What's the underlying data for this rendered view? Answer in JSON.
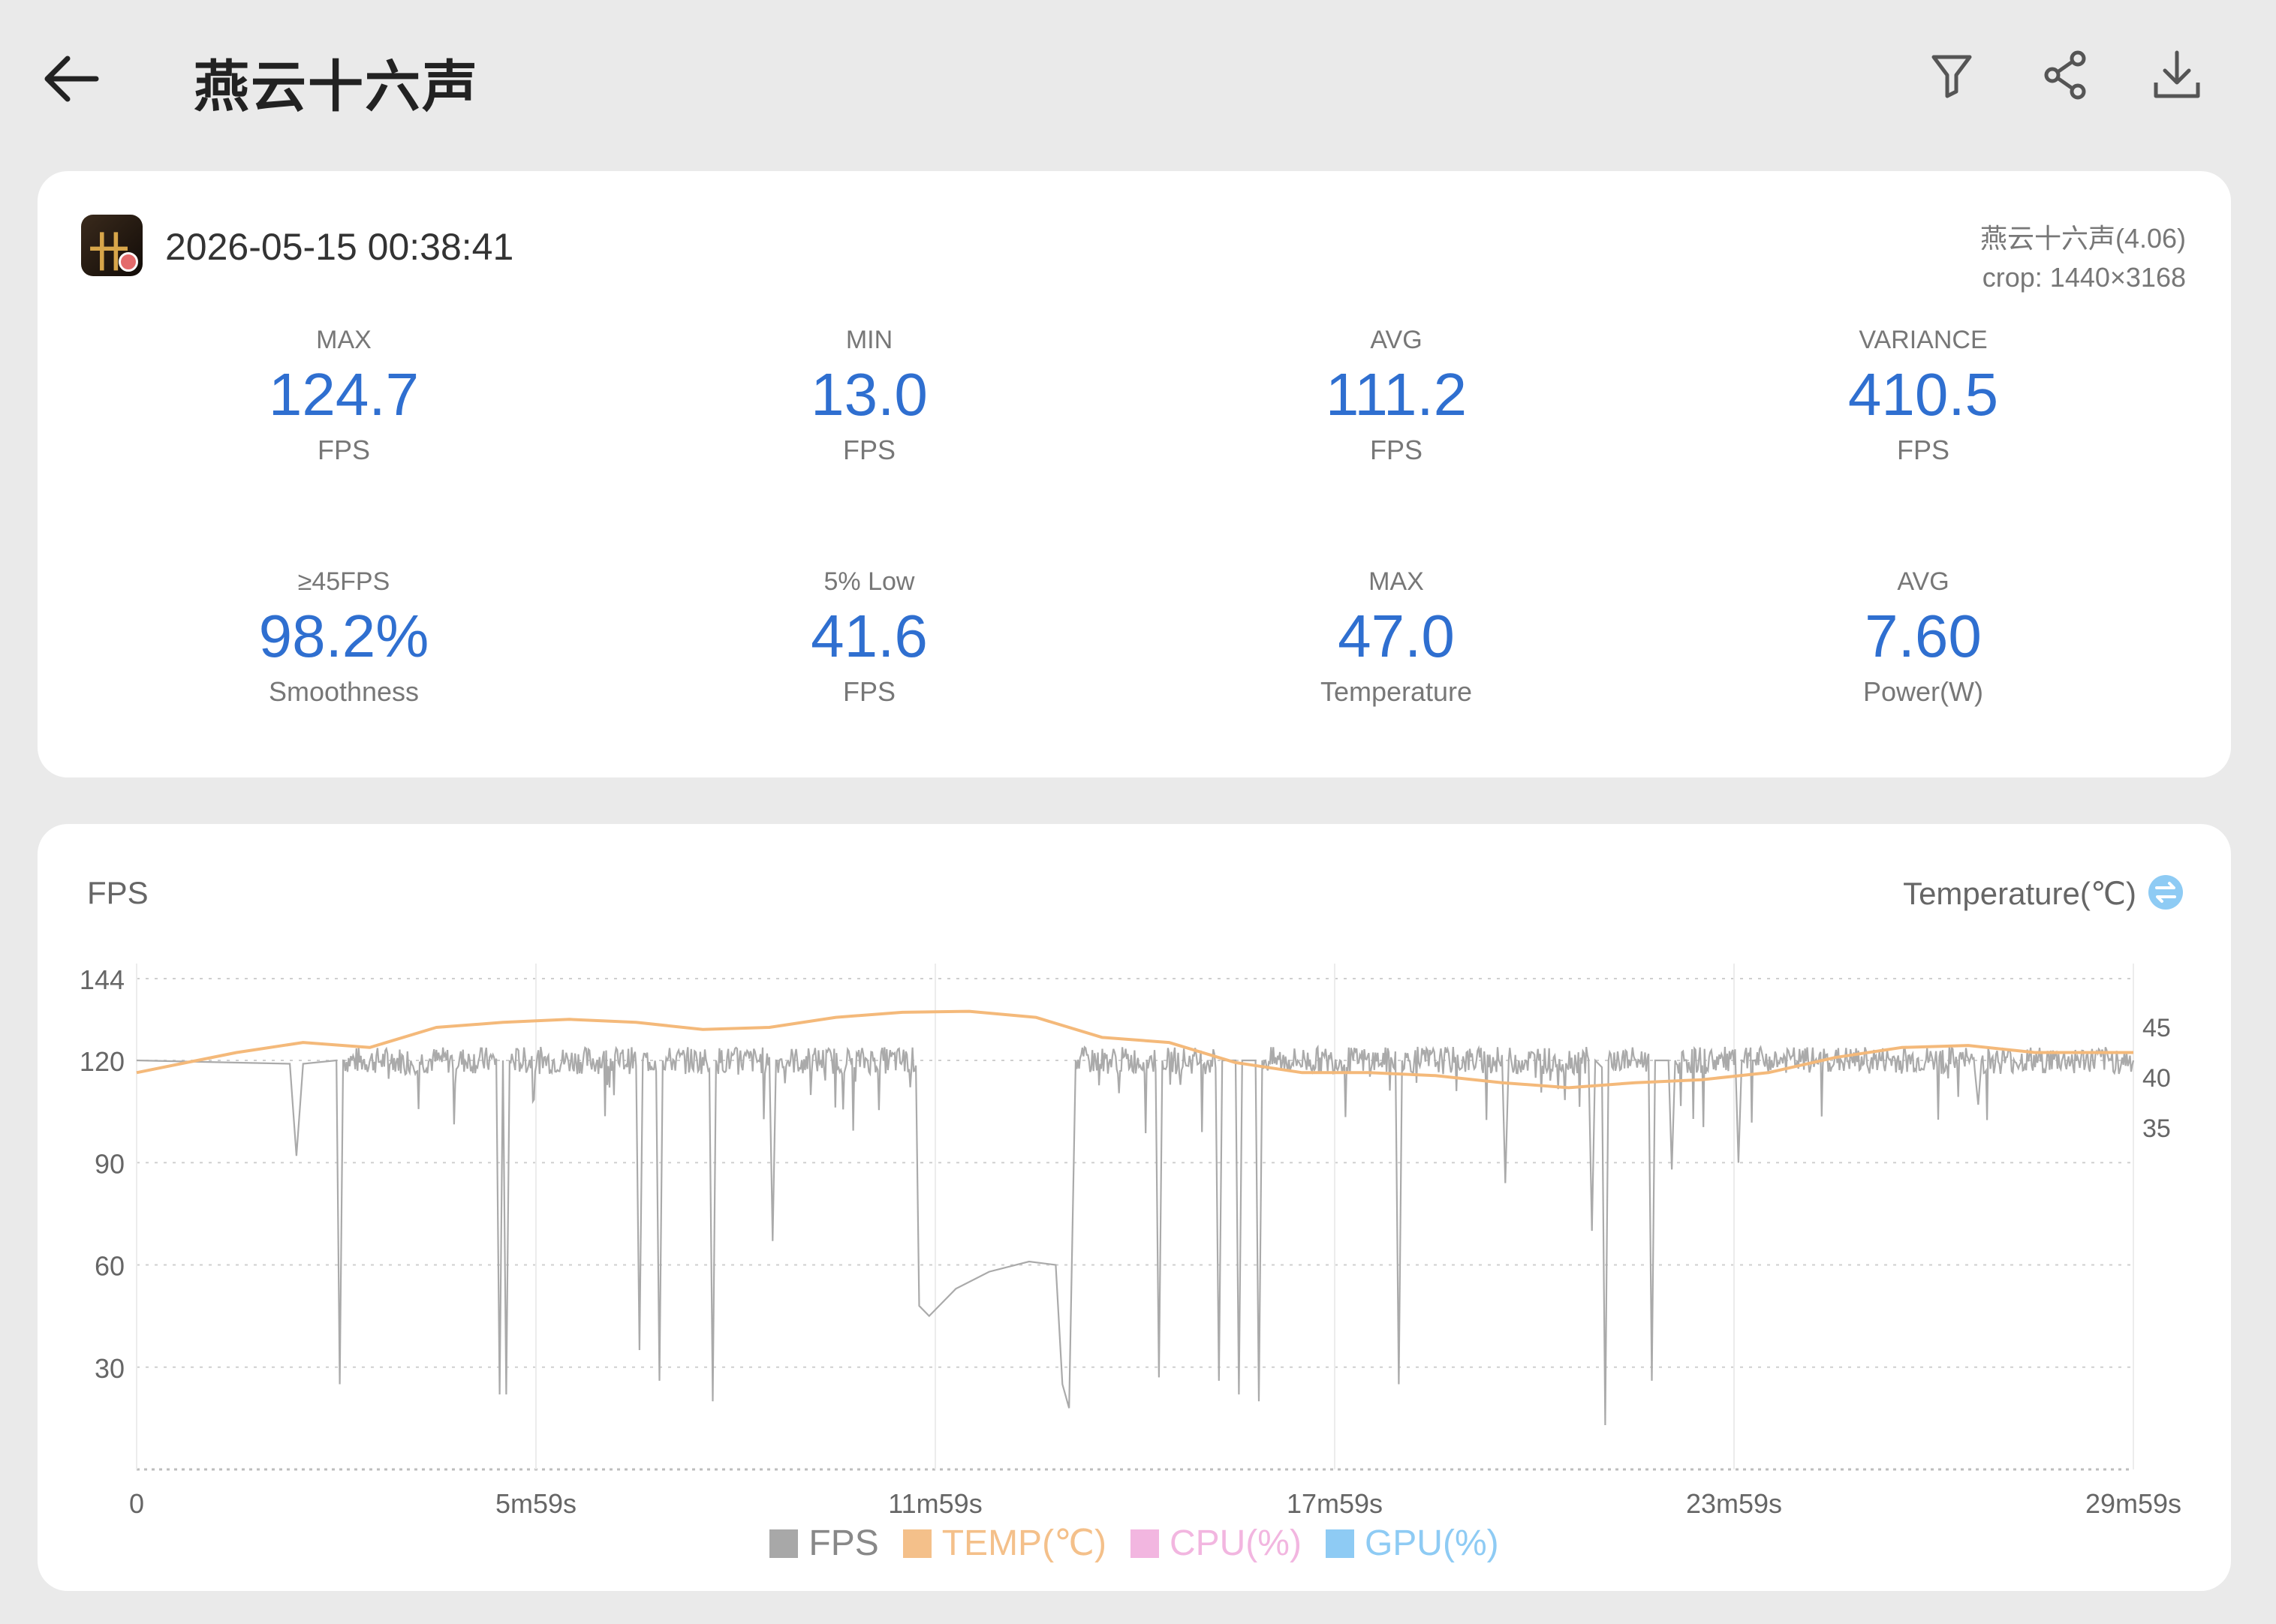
{
  "header": {
    "title": "燕云十六声"
  },
  "summary": {
    "datetime": "2026-05-15 00:38:41",
    "app_name": "燕云十六声(4.06)",
    "crop": "crop: 1440×3168",
    "stats_row1": [
      {
        "label": "MAX",
        "value": "124.7",
        "unit": "FPS"
      },
      {
        "label": "MIN",
        "value": "13.0",
        "unit": "FPS"
      },
      {
        "label": "AVG",
        "value": "111.2",
        "unit": "FPS"
      },
      {
        "label": "VARIANCE",
        "value": "410.5",
        "unit": "FPS"
      }
    ],
    "stats_row2": [
      {
        "label": "≥45FPS",
        "value": "98.2%",
        "unit": "Smoothness"
      },
      {
        "label": "5% Low",
        "value": "41.6",
        "unit": "FPS"
      },
      {
        "label": "MAX",
        "value": "47.0",
        "unit": "Temperature"
      },
      {
        "label": "AVG",
        "value": "7.60",
        "unit": "Power(W)"
      }
    ]
  },
  "chart": {
    "left_axis_title": "FPS",
    "right_axis_title": "Temperature(℃)",
    "legend": [
      {
        "label": "FPS",
        "color": "#a8a8a8"
      },
      {
        "label": "TEMP(℃)",
        "color": "#f4c08a"
      },
      {
        "label": "CPU(%)",
        "color": "#f2b6e0"
      },
      {
        "label": "GPU(%)",
        "color": "#8ecbf4"
      }
    ]
  },
  "chart_data": {
    "type": "line",
    "x_ticks": [
      "0",
      "5m59s",
      "11m59s",
      "17m59s",
      "23m59s",
      "29m59s"
    ],
    "x_range_minutes": [
      0,
      29.98
    ],
    "y_left": {
      "ticks": [
        144,
        120,
        90,
        60,
        30
      ],
      "range": [
        0,
        144
      ]
    },
    "y_right": {
      "ticks": [
        45,
        40,
        35
      ]
    },
    "grid": true,
    "legend_position": "bottom",
    "series": [
      {
        "name": "FPS",
        "color": "#aaaaaa",
        "baseline": 120,
        "points_minutes": [
          [
            0,
            120
          ],
          [
            2.3,
            119
          ],
          [
            2.4,
            92
          ],
          [
            2.5,
            119
          ],
          [
            3.0,
            120
          ],
          [
            3.05,
            25
          ],
          [
            3.1,
            120
          ],
          [
            5.4,
            120
          ],
          [
            5.45,
            22
          ],
          [
            5.5,
            120
          ],
          [
            5.55,
            22
          ],
          [
            5.6,
            120
          ],
          [
            7.5,
            120
          ],
          [
            7.55,
            35
          ],
          [
            7.6,
            120
          ],
          [
            7.8,
            120
          ],
          [
            7.85,
            26
          ],
          [
            7.9,
            120
          ],
          [
            8.6,
            120
          ],
          [
            8.65,
            20
          ],
          [
            8.7,
            120
          ],
          [
            9.5,
            120
          ],
          [
            9.55,
            67
          ],
          [
            9.6,
            120
          ],
          [
            11.7,
            120
          ],
          [
            11.75,
            48
          ],
          [
            11.9,
            45
          ],
          [
            12.3,
            53
          ],
          [
            12.8,
            58
          ],
          [
            13.4,
            61
          ],
          [
            13.8,
            60
          ],
          [
            13.9,
            25
          ],
          [
            14.0,
            18
          ],
          [
            14.1,
            120
          ],
          [
            15.3,
            120
          ],
          [
            15.35,
            27
          ],
          [
            15.4,
            120
          ],
          [
            16.2,
            120
          ],
          [
            16.25,
            26
          ],
          [
            16.3,
            120
          ],
          [
            16.5,
            120
          ],
          [
            16.55,
            22
          ],
          [
            16.6,
            120
          ],
          [
            16.8,
            120
          ],
          [
            16.85,
            20
          ],
          [
            16.9,
            120
          ],
          [
            18.9,
            120
          ],
          [
            18.95,
            25
          ],
          [
            19.0,
            120
          ],
          [
            20.5,
            120
          ],
          [
            20.55,
            84
          ],
          [
            20.6,
            120
          ],
          [
            21.8,
            120
          ],
          [
            21.85,
            70
          ],
          [
            21.9,
            120
          ],
          [
            22.0,
            118
          ],
          [
            22.05,
            13
          ],
          [
            22.1,
            120
          ],
          [
            22.7,
            120
          ],
          [
            22.75,
            26
          ],
          [
            22.8,
            120
          ],
          [
            23.0,
            120
          ],
          [
            23.05,
            88
          ],
          [
            23.1,
            120
          ],
          [
            24.0,
            120
          ],
          [
            24.05,
            90
          ],
          [
            24.1,
            120
          ],
          [
            27.6,
            120
          ],
          [
            27.65,
            107
          ],
          [
            27.7,
            120
          ],
          [
            29.98,
            120
          ]
        ]
      },
      {
        "name": "TEMP(℃)",
        "color": "#f4b97a",
        "points_minutes": [
          [
            0,
            40.5
          ],
          [
            1.5,
            42.5
          ],
          [
            2.5,
            43.5
          ],
          [
            3.5,
            43.0
          ],
          [
            4.5,
            45.0
          ],
          [
            5.5,
            45.5
          ],
          [
            6.5,
            45.8
          ],
          [
            7.5,
            45.5
          ],
          [
            8.5,
            44.8
          ],
          [
            9.5,
            45.0
          ],
          [
            10.5,
            46.0
          ],
          [
            11.5,
            46.5
          ],
          [
            12.5,
            46.6
          ],
          [
            13.5,
            46.0
          ],
          [
            14.5,
            44.0
          ],
          [
            15.5,
            43.5
          ],
          [
            16.5,
            41.5
          ],
          [
            17.5,
            40.5
          ],
          [
            18.5,
            40.5
          ],
          [
            19.5,
            40.2
          ],
          [
            20.5,
            39.5
          ],
          [
            21.5,
            39.0
          ],
          [
            22.5,
            39.5
          ],
          [
            23.5,
            39.8
          ],
          [
            24.5,
            40.5
          ],
          [
            25.5,
            42.0
          ],
          [
            26.5,
            43.0
          ],
          [
            27.5,
            43.2
          ],
          [
            28.5,
            42.5
          ],
          [
            29.98,
            42.5
          ]
        ]
      }
    ]
  }
}
